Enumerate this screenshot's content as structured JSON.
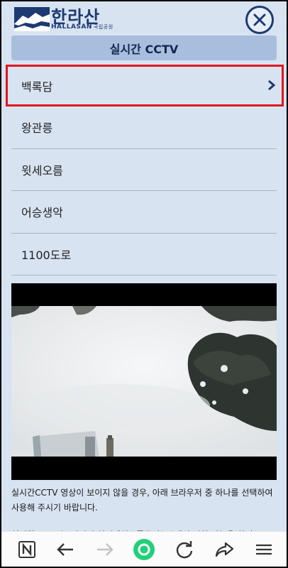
{
  "header": {
    "logo_script": "한라산",
    "logo_en": "HALLASAN",
    "logo_sub": "국립공원"
  },
  "title": "실시간 CCTV",
  "menu": [
    {
      "label": "백록담"
    },
    {
      "label": "왕관릉"
    },
    {
      "label": "윗세오름"
    },
    {
      "label": "어승생악"
    },
    {
      "label": "1100도로"
    }
  ],
  "notice": {
    "text": "실시간CCTV 영상이 보이지 않을 경우, 아래 브라우저 중 하나를 선택하여 사용해 주시기 바랍니다.",
    "partial_text": "실시간 CCTV는 파이어 인터넷익스플로러(IE)에서 지원 가능을 하지"
  },
  "colors": {
    "background": "#d7e3f0",
    "accent": "#1d3a73",
    "titlebar": "#a9bedd",
    "highlight": "#e0161e",
    "home": "#21d07a"
  }
}
